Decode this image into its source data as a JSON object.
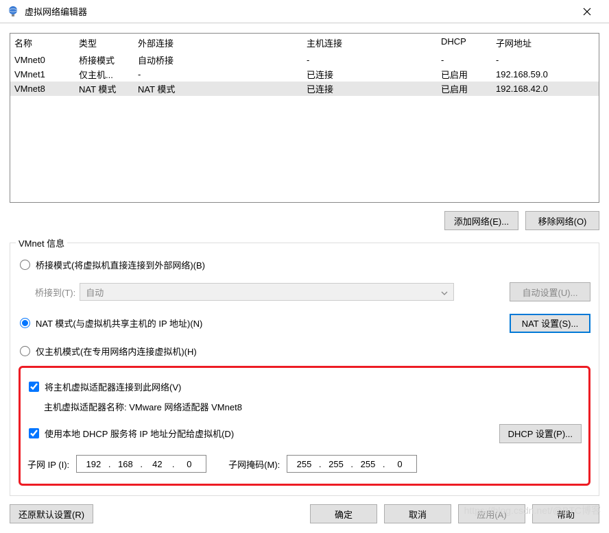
{
  "window": {
    "title": "虚拟网络编辑器"
  },
  "table": {
    "headers": {
      "name": "名称",
      "type": "类型",
      "ext": "外部连接",
      "host": "主机连接",
      "dhcp": "DHCP",
      "subnet": "子网地址"
    },
    "rows": [
      {
        "name": "VMnet0",
        "type": "桥接模式",
        "ext": "自动桥接",
        "host": "-",
        "dhcp": "-",
        "subnet": "-"
      },
      {
        "name": "VMnet1",
        "type": "仅主机...",
        "ext": "-",
        "host": "已连接",
        "dhcp": "已启用",
        "subnet": "192.168.59.0"
      },
      {
        "name": "VMnet8",
        "type": "NAT 模式",
        "ext": "NAT 模式",
        "host": "已连接",
        "dhcp": "已启用",
        "subnet": "192.168.42.0"
      }
    ]
  },
  "buttons": {
    "add_network": "添加网络(E)...",
    "remove_network": "移除网络(O)",
    "auto_settings": "自动设置(U)...",
    "nat_settings": "NAT 设置(S)...",
    "dhcp_settings": "DHCP 设置(P)...",
    "restore_defaults": "还原默认设置(R)",
    "ok": "确定",
    "cancel": "取消",
    "apply": "应用(A)",
    "help": "帮助"
  },
  "groupbox": {
    "title": "VMnet 信息",
    "opt_bridge": "桥接模式(将虚拟机直接连接到外部网络)(B)",
    "bridge_to_label": "桥接到(T):",
    "bridge_to_value": "自动",
    "opt_nat": "NAT 模式(与虚拟机共享主机的 IP 地址)(N)",
    "opt_hostonly": "仅主机模式(在专用网络内连接虚拟机)(H)",
    "chk_host_adapter": "将主机虚拟适配器连接到此网络(V)",
    "adapter_name": "主机虚拟适配器名称: VMware 网络适配器 VMnet8",
    "chk_dhcp": "使用本地 DHCP 服务将 IP 地址分配给虚拟机(D)",
    "subnet_ip_label": "子网 IP (I):",
    "subnet_mask_label": "子网掩码(M):"
  },
  "ip": {
    "oct1": "192",
    "oct2": "168",
    "oct3": "42",
    "oct4": "0"
  },
  "mask": {
    "oct1": "255",
    "oct2": "255",
    "oct3": "255",
    "oct4": "0"
  },
  "watermark": "https://blog.csdn.net/@BTC博客"
}
